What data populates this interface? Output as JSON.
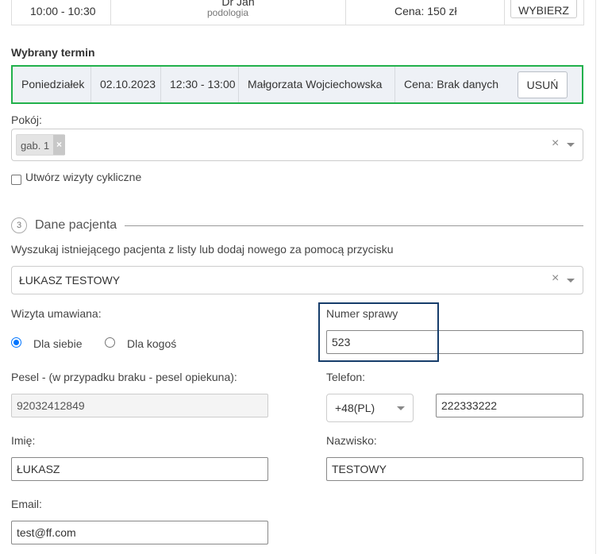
{
  "top_row": {
    "time": "10:00 - 10:30",
    "doctor": "Dr Jan Kowalski",
    "specialty": "podologia",
    "price": "Cena: 150 zł",
    "select_button": "WYBIERZ"
  },
  "selected_term": {
    "heading": "Wybrany termin",
    "day": "Poniedziałek",
    "date": "02.10.2023",
    "time": "12:30 - 13:00",
    "doctor": "Małgorzata Wojciechowska",
    "price": "Cena: Brak danych",
    "remove_button": "USUŃ"
  },
  "room": {
    "label": "Pokój:",
    "tag": "gab. 1",
    "tag_remove": "×",
    "clear": "×"
  },
  "cyclic": {
    "label": "Utwórz wizyty cykliczne",
    "checked": false
  },
  "patient_section": {
    "step": "3",
    "title": "Dane pacjenta",
    "hint": "Wyszukaj istniejącego pacjenta z listy lub dodaj nowego za pomocą przycisku",
    "selected_patient": "ŁUKASZ TESTOWY",
    "clear": "×"
  },
  "visit_for": {
    "label": "Wizyta umawiana:",
    "option_self": "Dla siebie",
    "option_other": "Dla kogoś",
    "selected": "Dla siebie"
  },
  "case_number": {
    "label": "Numer sprawy",
    "value": "523"
  },
  "pesel": {
    "label": "Pesel - (w przypadku braku - pesel opiekuna):",
    "value": "92032412849"
  },
  "phone": {
    "label": "Telefon:",
    "prefix": "+48(PL)",
    "value": "222333222"
  },
  "first_name": {
    "label": "Imię:",
    "value": "ŁUKASZ"
  },
  "last_name": {
    "label": "Nazwisko:",
    "value": "TESTOWY"
  },
  "email": {
    "label": "Email:",
    "value": "test@ff.com"
  },
  "colors": {
    "selected_term_border": "#22b14c",
    "selected_term_bg": "#eef1f6",
    "highlight_border": "#163d6b",
    "radio_accent": "#0075ff"
  }
}
